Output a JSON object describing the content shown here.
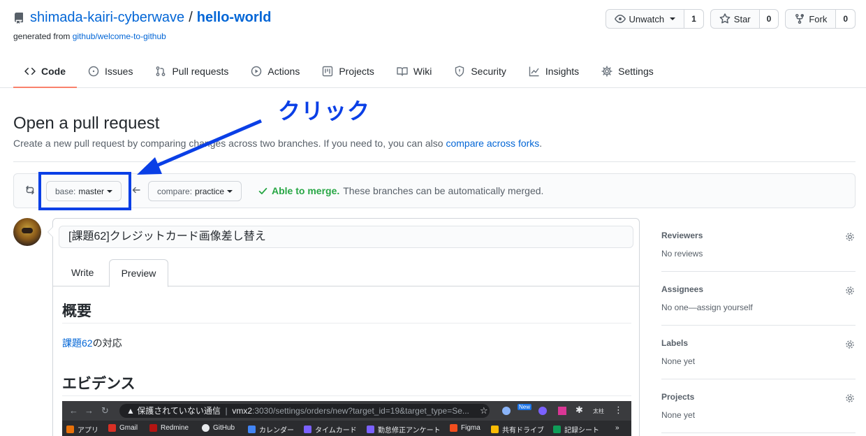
{
  "repo": {
    "owner": "shimada-kairi-cyberwave",
    "separator": "/",
    "name": "hello-world",
    "generated_prefix": "generated from ",
    "generated_link": "github/welcome-to-github"
  },
  "actions": {
    "watch": {
      "label": "Unwatch",
      "count": "1"
    },
    "star": {
      "label": "Star",
      "count": "0"
    },
    "fork": {
      "label": "Fork",
      "count": "0"
    }
  },
  "tabs": [
    {
      "label": "Code",
      "icon": "code-icon",
      "selected": true
    },
    {
      "label": "Issues",
      "icon": "issue-icon"
    },
    {
      "label": "Pull requests",
      "icon": "pull-request-icon"
    },
    {
      "label": "Actions",
      "icon": "play-icon"
    },
    {
      "label": "Projects",
      "icon": "project-icon"
    },
    {
      "label": "Wiki",
      "icon": "book-icon"
    },
    {
      "label": "Security",
      "icon": "shield-icon"
    },
    {
      "label": "Insights",
      "icon": "graph-icon"
    },
    {
      "label": "Settings",
      "icon": "gear-icon"
    }
  ],
  "subhead": {
    "title": "Open a pull request",
    "description": "Create a new pull request by comparing changes across two branches. If you need to, you can also ",
    "link": "compare across forks",
    "suffix": "."
  },
  "range": {
    "base_label": "base:",
    "base_value": "master",
    "compare_label": "compare:",
    "compare_value": "practice",
    "merge_ok": "Able to merge.",
    "merge_text": "These branches can be automatically merged."
  },
  "annotation": {
    "text": "クリック",
    "color": "#0a3fe6"
  },
  "compose": {
    "title_value": "[課題62]クレジットカード画像差し替え",
    "tab_write": "Write",
    "tab_preview": "Preview",
    "heading1": "概要",
    "para_link": "課題62",
    "para_text": "の対応",
    "heading2": "エビデンス"
  },
  "embedded_shot": {
    "warn_text": "保護されていない通信",
    "url_host": "vmx2",
    "url_rest": ":3030/settings/orders/new?target_id=19&target_type=Se...",
    "new_badge": "New",
    "avatar_text": "太柱",
    "bookmarks": [
      "アプリ",
      "Gmail",
      "Redmine",
      "GitHub",
      "カレンダー",
      "タイムカード",
      "勤怠修正アンケート",
      "Figma",
      "共有ドライブ",
      "記録シート"
    ],
    "more": "»"
  },
  "sidebar": [
    {
      "heading": "Reviewers",
      "value": "No reviews"
    },
    {
      "heading": "Assignees",
      "value": "No one—assign yourself"
    },
    {
      "heading": "Labels",
      "value": "None yet"
    },
    {
      "heading": "Projects",
      "value": "None yet"
    }
  ],
  "colors": {
    "link": "#0366d6",
    "success": "#28a745",
    "tab_underline": "#f9826c",
    "annotation": "#0a3fe6"
  }
}
